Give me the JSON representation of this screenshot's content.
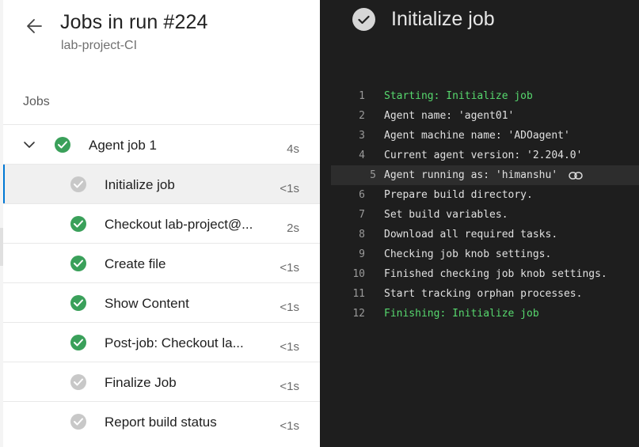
{
  "header": {
    "title": "Jobs in run #224",
    "subtitle": "lab-project-CI"
  },
  "jobs_heading": "Jobs",
  "jobs": [
    {
      "label": "Agent job 1",
      "duration": "4s",
      "status": "succeeded",
      "level": "parent"
    },
    {
      "label": "Initialize job",
      "duration": "<1s",
      "status": "skipped",
      "level": "child",
      "selected": true
    },
    {
      "label": "Checkout lab-project@...",
      "duration": "2s",
      "status": "succeeded",
      "level": "child"
    },
    {
      "label": "Create file",
      "duration": "<1s",
      "status": "succeeded",
      "level": "child"
    },
    {
      "label": "Show Content",
      "duration": "<1s",
      "status": "succeeded",
      "level": "child"
    },
    {
      "label": "Post-job: Checkout la...",
      "duration": "<1s",
      "status": "succeeded",
      "level": "child"
    },
    {
      "label": "Finalize Job",
      "duration": "<1s",
      "status": "skipped",
      "level": "child"
    },
    {
      "label": "Report build status",
      "duration": "<1s",
      "status": "skipped",
      "level": "child"
    }
  ],
  "log_panel": {
    "title": "Initialize job",
    "lines": [
      {
        "num": "1",
        "text": "Starting: Initialize job",
        "section": true
      },
      {
        "num": "2",
        "text": "Agent name: 'agent01'"
      },
      {
        "num": "3",
        "text": "Agent machine name: 'ADOagent'"
      },
      {
        "num": "4",
        "text": "Current agent version: '2.204.0'"
      },
      {
        "num": "5",
        "text": "Agent running as: 'himanshu'",
        "highlighted": true
      },
      {
        "num": "6",
        "text": "Prepare build directory."
      },
      {
        "num": "7",
        "text": "Set build variables."
      },
      {
        "num": "8",
        "text": "Download all required tasks."
      },
      {
        "num": "9",
        "text": "Checking job knob settings."
      },
      {
        "num": "10",
        "text": "Finished checking job knob settings."
      },
      {
        "num": "11",
        "text": "Start tracking orphan processes."
      },
      {
        "num": "12",
        "text": "Finishing: Initialize job",
        "section": true
      }
    ]
  },
  "colors": {
    "success": "#3aa05a",
    "skipped": "#c8c8c8",
    "selected_accent": "#0078d4",
    "log_background": "#1e1e1e",
    "log_section": "#57d86e"
  },
  "icons": {
    "back": "arrow-left-icon",
    "expand": "chevron-down-icon",
    "success": "check-circle-icon",
    "skipped": "check-circle-gray-icon",
    "link": "link-icon"
  }
}
